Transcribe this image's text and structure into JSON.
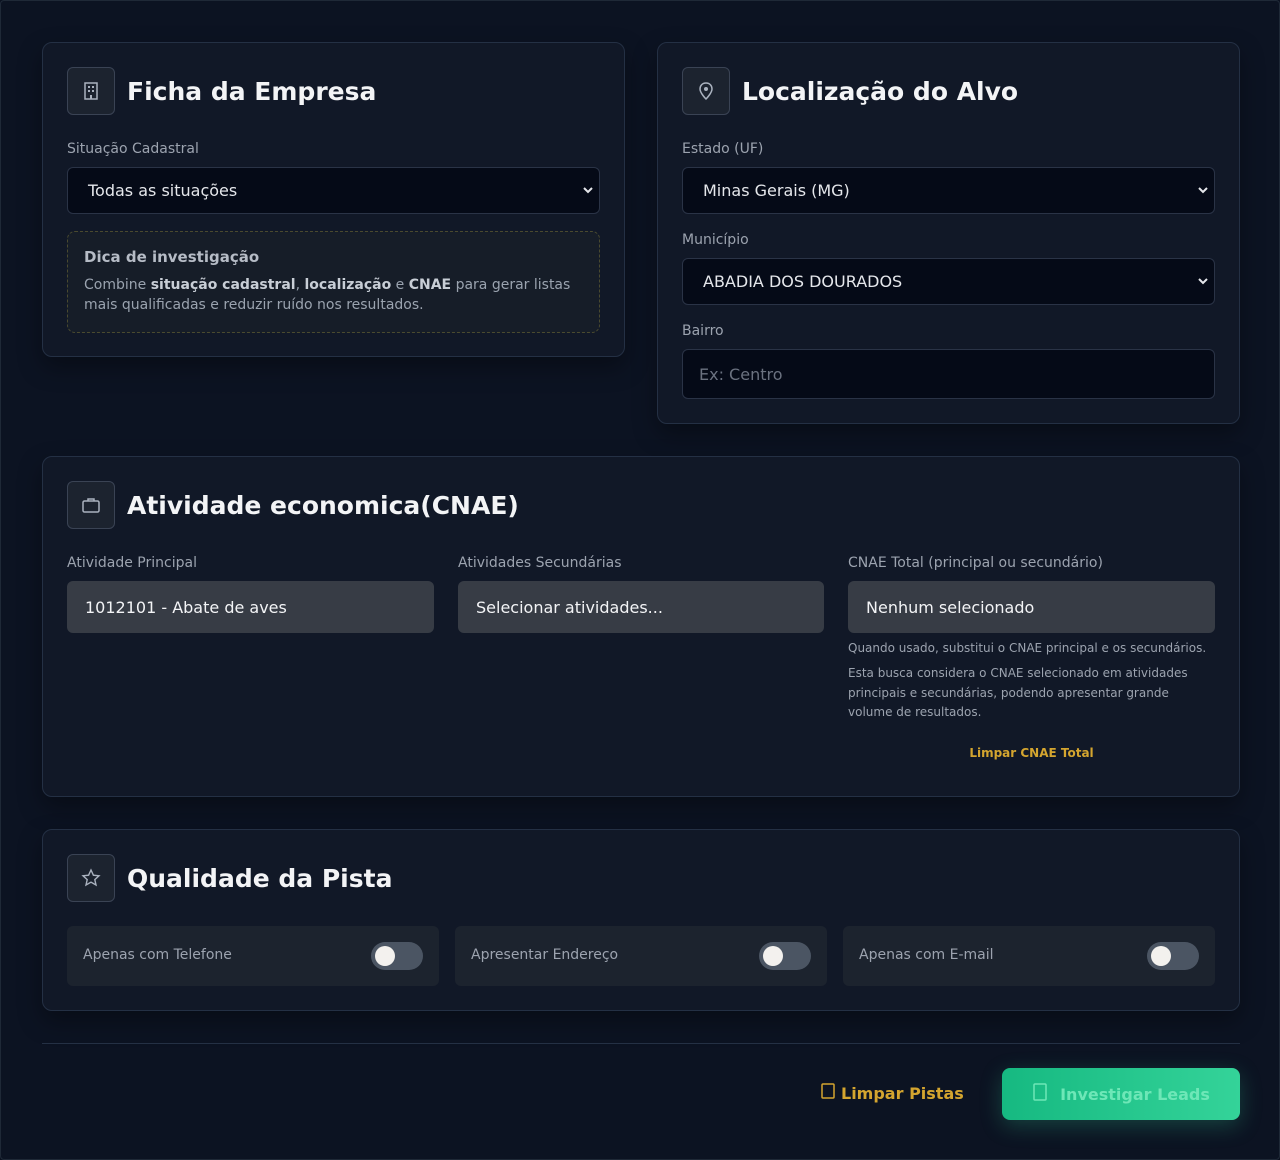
{
  "company": {
    "title": "Ficha da Empresa",
    "icon": "building-icon",
    "status_label": "Situação Cadastral",
    "status_value": "Todas as situações",
    "tip": {
      "title": "Dica de investigação",
      "prefix": "Combine ",
      "b1": "situação cadastral",
      "sep1": ", ",
      "b2": "localização",
      "sep2": " e ",
      "b3": "CNAE",
      "suffix": " para gerar listas mais qualificadas e reduzir ruído nos resultados."
    }
  },
  "location": {
    "title": "Localização do Alvo",
    "icon": "map-pin-icon",
    "state_label": "Estado (UF)",
    "state_value": "Minas Gerais (MG)",
    "city_label": "Município",
    "city_value": "ABADIA DOS DOURADOS",
    "district_label": "Bairro",
    "district_placeholder": "Ex: Centro"
  },
  "cnae": {
    "title": "Atividade economica(CNAE)",
    "icon": "briefcase-icon",
    "main_label": "Atividade Principal",
    "main_value": "1012101 - Abate de aves",
    "secondary_label": "Atividades Secundárias",
    "secondary_value": "Selecionar atividades...",
    "total_label": "CNAE Total (principal ou secundário)",
    "total_value": "Nenhum selecionado",
    "note1": "Quando usado, substitui o CNAE principal e os secundários.",
    "note2": "Esta busca considera o CNAE selecionado em atividades principais e secundárias, podendo apresentar grande volume de resultados.",
    "clear_total": "Limpar CNAE Total"
  },
  "quality": {
    "title": "Qualidade da Pista",
    "icon": "star-icon",
    "toggles": [
      {
        "label": "Apenas com Telefone",
        "on": false
      },
      {
        "label": "Apresentar Endereço",
        "on": false
      },
      {
        "label": "Apenas com E-mail",
        "on": false
      }
    ]
  },
  "actions": {
    "clear": "Limpar Pistas",
    "clear_icon": "broom-icon",
    "search": "Investigar Leads",
    "search_icon": "search-icon"
  },
  "colors": {
    "accent_green": "#34d399",
    "accent_yellow": "#d4a52f",
    "background": "#0b1120"
  }
}
